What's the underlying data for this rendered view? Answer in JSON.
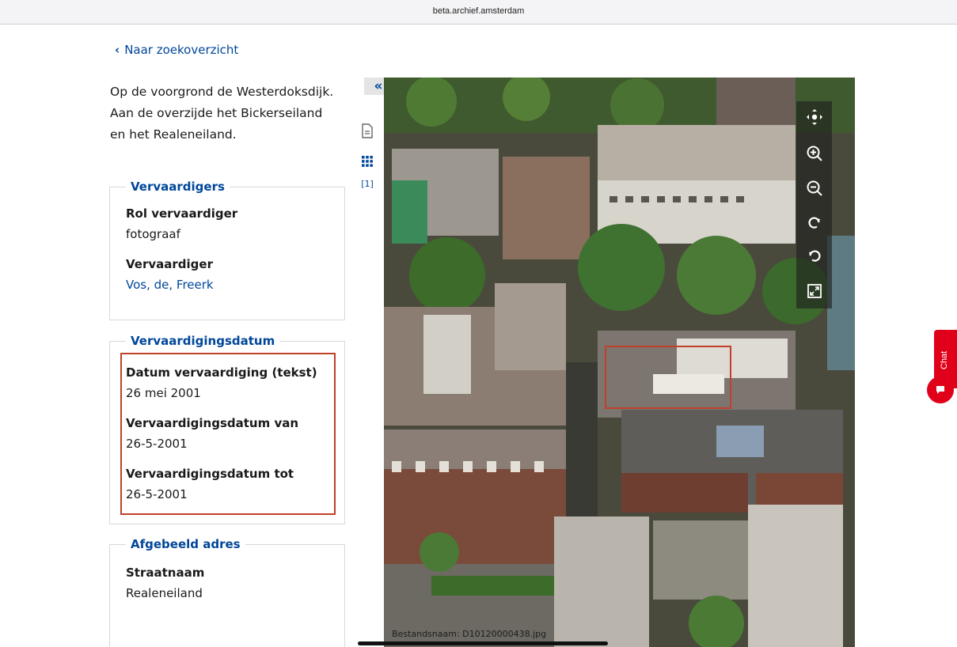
{
  "browser": {
    "url": "beta.archief.amsterdam"
  },
  "nav": {
    "back_label": "Naar zoekoverzicht"
  },
  "record": {
    "description": "Op de voorgrond de Westerdoksdijk. Aan de overzijde het Bickerseiland en het Realeneiland."
  },
  "makers": {
    "legend": "Vervaardigers",
    "role_label": "Rol vervaardiger",
    "role_value": "fotograaf",
    "maker_label": "Vervaardiger",
    "maker_value": "Vos, de, Freerk"
  },
  "dates": {
    "legend": "Vervaardigingsdatum",
    "text_label": "Datum vervaardiging (tekst)",
    "text_value": "26 mei 2001",
    "from_label": "Vervaardigingsdatum van",
    "from_value": "26-5-2001",
    "to_label": "Vervaardigingsdatum tot",
    "to_value": "26-5-2001"
  },
  "address": {
    "legend": "Afgebeeld adres",
    "street_label": "Straatnaam",
    "street_value": "Realeneiland"
  },
  "viewer": {
    "collapse_label": "«",
    "expand_label": "»",
    "page_count": "[1]",
    "filename": "Bestandsnaam: D10120000438.jpg",
    "icons": [
      "document-icon",
      "grid-icon",
      "pan-icon",
      "zoom-in-icon",
      "zoom-out-icon",
      "rotate-right-icon",
      "rotate-left-icon",
      "fullscreen-icon"
    ]
  },
  "chat": {
    "label": "Chat"
  },
  "colors": {
    "accent": "#004699",
    "chat": "#e0001a",
    "highlight": "#c0402a"
  }
}
